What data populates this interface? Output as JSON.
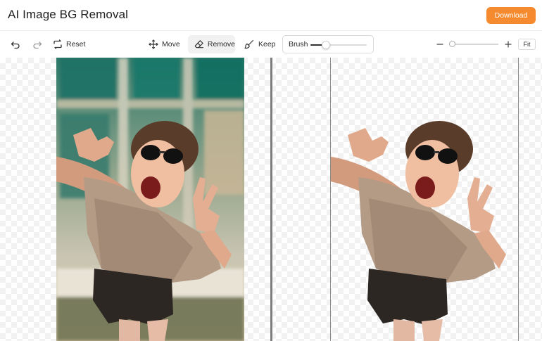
{
  "app": {
    "title": "AI Image BG Removal"
  },
  "header": {
    "download_label": "Download"
  },
  "toolbar": {
    "reset_label": "Reset",
    "move_label": "Move",
    "remove_label": "Remove",
    "keep_label": "Keep",
    "brush_label": "Brush",
    "brush_level": 0.27,
    "active_tool": "remove",
    "zoom_level": 0.02,
    "fit_label": "Fit"
  },
  "colors": {
    "accent": "#f58a2e",
    "active_tool_bg": "#f1f1f1",
    "divider": "#7d7d7d"
  },
  "icons": [
    "undo-icon",
    "redo-icon",
    "reset-icon",
    "move-icon",
    "eraser-icon",
    "brush-icon",
    "zoom-out-icon",
    "zoom-in-icon"
  ]
}
